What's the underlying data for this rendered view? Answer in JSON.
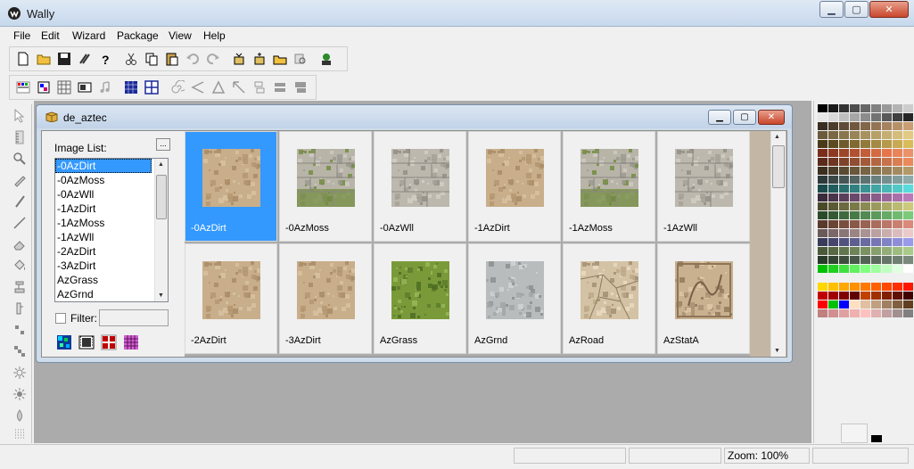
{
  "app": {
    "title": "Wally"
  },
  "window_controls": {
    "minimize": "▁",
    "maximize": "▢",
    "close": "✕"
  },
  "menu": [
    "File",
    "Edit",
    "Wizard",
    "Package",
    "View",
    "Help"
  ],
  "toolbar1_icons": [
    "new-icon",
    "open-icon",
    "save-icon",
    "wizard-icon",
    "help-icon",
    "cut-icon",
    "copy-icon",
    "paste-icon",
    "undo-icon",
    "redo-icon",
    "package-open-icon",
    "package-add-icon",
    "package-folder-icon",
    "package-search-icon",
    "run-icon"
  ],
  "toolbar2_icons": [
    "palette-view-icon",
    "color-view-icon",
    "grid-view-icon",
    "image-view-icon",
    "sound-view-icon",
    "grid-fill-icon",
    "grid-lines-icon",
    "spiral-tool-icon",
    "lines-tool-icon",
    "triangle-tool-icon",
    "arrow-tool-icon",
    "rect-tool-icon",
    "rect-fill-tool-icon",
    "rect-dark-tool-icon"
  ],
  "left_tools": [
    "pointer-icon",
    "ruler-icon",
    "magnifier-icon",
    "pencil-icon",
    "brush-icon",
    "line-icon",
    "eraser-icon",
    "fill-icon",
    "stamp-icon",
    "smudge-icon",
    "blend-icon",
    "pixel-icon",
    "sun-icon",
    "burst-icon",
    "drop-icon",
    "spray-icon"
  ],
  "child": {
    "title": "de_aztec",
    "image_list_label": "Image List:",
    "more_label": "...",
    "list": [
      "-0AzDirt",
      "-0AzMoss",
      "-0AzWll",
      "-1AzDirt",
      "-1AzMoss",
      "-1AzWll",
      "-2AzDirt",
      "-3AzDirt",
      "AzGrass",
      "AzGrnd"
    ],
    "selected_index": 0,
    "filter_label": "Filter:",
    "filter_value": "",
    "thumbnails": [
      {
        "label": "-0AzDirt",
        "texture": "dirt",
        "selected": true
      },
      {
        "label": "-0AzMoss",
        "texture": "moss"
      },
      {
        "label": "-0AzWll",
        "texture": "wall"
      },
      {
        "label": "-1AzDirt",
        "texture": "dirt"
      },
      {
        "label": "-1AzMoss",
        "texture": "moss"
      },
      {
        "label": "-1AzWll",
        "texture": "wall"
      },
      {
        "label": "-2AzDirt",
        "texture": "dirt"
      },
      {
        "label": "-3AzDirt",
        "texture": "dirt"
      },
      {
        "label": "AzGrass",
        "texture": "grass"
      },
      {
        "label": "AzGrnd",
        "texture": "ground"
      },
      {
        "label": "AzRoad",
        "texture": "road"
      },
      {
        "label": "AzStatA",
        "texture": "statue"
      }
    ]
  },
  "status": {
    "zoom": "Zoom: 100%"
  },
  "colors": {
    "selection": "#3399ff",
    "workspace": "#ababab",
    "palette": [
      "#000000",
      "#1a1a1a",
      "#333333",
      "#4d4d4d",
      "#666666",
      "#808080",
      "#999999",
      "#b3b3b3",
      "#cccccc",
      "#e6e6e6",
      "#d9d9d9",
      "#bfbfbf",
      "#a6a6a6",
      "#8c8c8c",
      "#737373",
      "#595959",
      "#404040",
      "#262626",
      "#3a2e22",
      "#4c3c2c",
      "#5e4a36",
      "#705840",
      "#82664a",
      "#947454",
      "#a6825e",
      "#b89068",
      "#ca9e72",
      "#6b5a3b",
      "#7a6844",
      "#89764d",
      "#988456",
      "#a7925f",
      "#b6a068",
      "#c5ae71",
      "#d4bc7a",
      "#e3ca83",
      "#4a3a1a",
      "#5c4a22",
      "#6e5a2a",
      "#806a32",
      "#927a3a",
      "#a48a42",
      "#b69a4a",
      "#c8aa52",
      "#dabb5a",
      "#7a2e1a",
      "#8c3a22",
      "#9e462a",
      "#b05232",
      "#c25e3a",
      "#d46a42",
      "#e6764a",
      "#e8845a",
      "#ea926a",
      "#5a2a1a",
      "#6c3622",
      "#7e422a",
      "#904e32",
      "#a25a3a",
      "#b46642",
      "#c6724a",
      "#d87e52",
      "#ea8a5a",
      "#3b3020",
      "#4a3d29",
      "#594a32",
      "#68573b",
      "#776444",
      "#86714d",
      "#957e56",
      "#a48b5f",
      "#b39868",
      "#2e3a3a",
      "#3a4848",
      "#465656",
      "#526464",
      "#5e7272",
      "#6a8080",
      "#768e8e",
      "#829c9c",
      "#8eaaaa",
      "#1a4a4a",
      "#225c5c",
      "#2a6e6e",
      "#328080",
      "#3a9292",
      "#42a4a4",
      "#4ab6b6",
      "#52c8c8",
      "#5adada",
      "#3a2a3a",
      "#4a344a",
      "#5a3e5a",
      "#6a486a",
      "#7a527a",
      "#8a5c8a",
      "#9a669a",
      "#aa70aa",
      "#ba7aba",
      "#4a4a2a",
      "#5a5a34",
      "#6a6a3e",
      "#7a7a48",
      "#8a8a52",
      "#9a9a5c",
      "#aaaa66",
      "#baba70",
      "#caca7a",
      "#2a4a2a",
      "#345a34",
      "#3e6a3e",
      "#487a48",
      "#528a52",
      "#5c9a5c",
      "#66aa66",
      "#70ba70",
      "#7aca7a",
      "#5a3a2a",
      "#6a4434",
      "#7a4e3e",
      "#8a5848",
      "#9a6252",
      "#aa6c5c",
      "#ba7666",
      "#ca8070",
      "#da8a7a",
      "#6a5a5a",
      "#7a6868",
      "#8a7676",
      "#9a8484",
      "#aa9292",
      "#baa0a0",
      "#caaeae",
      "#dabcbc",
      "#eacaca",
      "#3a3a5a",
      "#46466c",
      "#52527e",
      "#5e5e90",
      "#6a6aa2",
      "#7676b4",
      "#8282c6",
      "#8e8ed8",
      "#9a9aea",
      "#4a5a3a",
      "#566844",
      "#62764e",
      "#6e8458",
      "#7a9262",
      "#86a06c",
      "#92ae76",
      "#9ebc80",
      "#aaca8a",
      "#2a3a2a",
      "#344434",
      "#3e4e3e",
      "#485848",
      "#526252",
      "#5c6c5c",
      "#667666",
      "#708070",
      "#7a8a7a",
      "#00c000",
      "#20d020",
      "#40e040",
      "#60f060",
      "#80ff80",
      "#a0ffa0",
      "#c0ffc0",
      "#e0ffe0",
      "#ffffff",
      "#f0f0f0",
      "#f0f0f0",
      "#f0f0f0",
      "#f0f0f0",
      "#f0f0f0",
      "#f0f0f0",
      "#f0f0f0",
      "#f0f0f0",
      "#f0f0f0",
      "#ffd700",
      "#ffc000",
      "#ffa800",
      "#ff9000",
      "#ff7800",
      "#ff6000",
      "#ff4800",
      "#ff3000",
      "#ff1800",
      "#c00000",
      "#a00000",
      "#800000",
      "#600000",
      "#c04000",
      "#a03000",
      "#802000",
      "#601000",
      "#400000",
      "#ff0000",
      "#00c000",
      "#0000ff",
      "#ffe0c0",
      "#e0c0a0",
      "#c0a080",
      "#a08060",
      "#806040",
      "#604020",
      "#c08080",
      "#d09090",
      "#e0a0a0",
      "#f0b0b0",
      "#ffc0c0",
      "#e0b0b0",
      "#c0a0a0",
      "#a09090",
      "#808080"
    ]
  }
}
